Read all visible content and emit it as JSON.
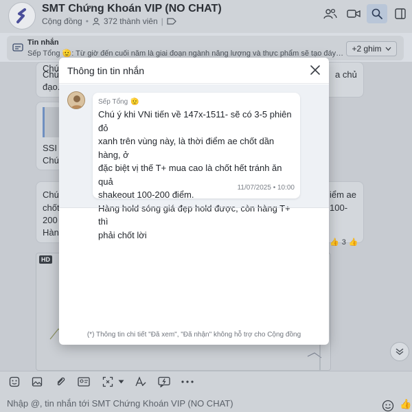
{
  "header": {
    "title": "SMT Chứng Khoán VIP (NO CHAT)",
    "category": "Cộng đồng",
    "members": "372 thành viên"
  },
  "pinned": {
    "label": "Tin nhắn",
    "preview": "Sếp Tổng 🫡: Từ giờ đến cuối năm là giai đoạn ngành năng lượng và thực phẩm sẽ tạo đáy và đi ...",
    "more_label": "+2 ghim"
  },
  "background_chat": {
    "bubble1_lines": [
      "Chú",
      "Chú",
      "đạo.",
      "a chủ"
    ],
    "bubble2_lines": [
      "SSI h",
      "Chú"
    ],
    "bubble3_lines": [
      "Chú",
      "chốt",
      "200",
      "Hàng"
    ],
    "bubble3_right": [
      "iểm ae",
      "100-"
    ],
    "video_badge": "HD",
    "reaction_count": "3"
  },
  "modal": {
    "title": "Thông tin tin nhắn",
    "sender": "Sếp Tổng",
    "message_lines": [
      "Chú ý khi VNi tiến về 147x-1511- sẽ có 3-5 phiên đỏ",
      "xanh trên vùng này, là thời điểm ae chốt dần hàng, ở",
      "đặc biệt vị thế T+ mua cao là chốt hết tránh ăn quả",
      "shakeout 100-200 điểm.",
      "Hàng hold sóng giá đẹp hold được, còn hàng T+ thì",
      "phải chốt lời"
    ],
    "time": "11/07/2025 • 10:00",
    "footnote": "(*) Thông tin chi tiết \"Đã xem\", \"Đã nhận\" không hỗ trợ cho Cộng đồng"
  },
  "composer": {
    "placeholder": "Nhập @, tin nhắn tới SMT Chứng Khoán VIP (NO CHAT)"
  },
  "colors": {
    "accent": "#2f6fd1",
    "overlay": "#c7cbd1",
    "modal_bg": "#ffffff"
  }
}
